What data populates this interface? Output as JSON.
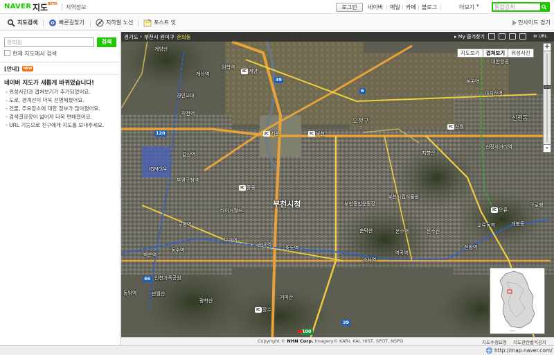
{
  "header": {
    "logo": "NAVER",
    "service": "지도",
    "beta": "BETA",
    "local_info": "지역정보",
    "login": "로그인",
    "nav": [
      "네이버",
      "메일",
      "카페",
      "블로그",
      "더보기"
    ],
    "search_placeholder": "통합검색"
  },
  "toolbar": {
    "search": "지도검색",
    "route": "빠른길찾기",
    "subway": "지하철 노선",
    "postit": "포스트 잇",
    "insight": "인사이드 경기"
  },
  "left_panel": {
    "search_value": "한의원",
    "search_button": "검색",
    "search_here_label": "현재 지도에서 검색",
    "notice_head": "[안내]",
    "new_badge": "NEW",
    "notice_title": "네이버 지도가 새롭게 바뀌었습니다!",
    "notice_lines": [
      "- 위성사진과 겹쳐보기가 추가되었어요.",
      "- 도로, 경계선이 더욱 선명해졌어요.",
      "- 건물, 주요장소에 대한 정보가 많아졌어요.",
      "- 검색결과창이 넓어져 더욱 편해졌어요.",
      "- URL 기능으로 친구에게 지도를 보내주세요."
    ]
  },
  "map": {
    "breadcrumb": [
      "경기도",
      "부천시 원미구",
      "춘의동"
    ],
    "my_favorites": "My 즐겨찾기",
    "url_label": "URL",
    "map_types": [
      {
        "label": "지도보기",
        "active": false
      },
      {
        "label": "겹쳐보기",
        "active": true
      },
      {
        "label": "위성사진",
        "active": false
      }
    ],
    "zoom_in": "+",
    "zoom_out": "-",
    "labels": {
      "gyeyangsan": "계양산",
      "imhakyeok": "임학역",
      "gyesanyeok": "계산역",
      "ic_gyeyang": "계양",
      "daehanhanggong": "대한항공",
      "hwagokyeok": "화곡역",
      "gyeongincollege": "경인교대",
      "jakjeonyeok": "작전역",
      "kkachisan": "까치산역",
      "sinjeongdong": "신정동",
      "ojeonggu": "오정구",
      "ic_seoun": "서운",
      "jc_bucheon": "부천",
      "ic_sinwol": "신월",
      "galsanyeok": "갈산역",
      "jihyangsan": "지향산",
      "sinjeongsageori": "신정사거리역",
      "igmdaewoo": "IGM대우",
      "bupyeonggucheong": "부평구청역",
      "ic_jungdong": "중동",
      "bucheonsicheong": "부천시청",
      "bucheonjonghap": "부천종합운동장",
      "bucheonsiripsikmulwon": "부천시립식물원",
      "ic_oryu": "오류",
      "oryudongyeok": "오류동역",
      "gaebongdong": "개봉동",
      "gurohaeng": "구로행",
      "taiguwaldeu": "타이거월드",
      "chundeoksan": "춘덕산",
      "onsuyeok": "온수역",
      "onsusan": "온수산",
      "bupyeongyeok": "부평역",
      "bugaeyeok": "부개역",
      "songnaeyeok": "송내역",
      "jungdongyeok": "중동역",
      "sosayeok": "소사역",
      "yeokgokyeok": "역곡역",
      "cheonwangyeok": "천왕역",
      "dongsuyeok": "동수역",
      "baegunyeok": "백운역",
      "incheongajokpark": "인천가족공원",
      "dongamyeok": "동암역",
      "manwolsan": "만월산",
      "gwanghaksan": "광학산",
      "geomasan": "거마산",
      "ic_jangsu": "장수",
      "route_39": "39",
      "route_6": "6",
      "route_120": "120",
      "route_46": "46",
      "route_39b": "39",
      "route_100": "100"
    }
  },
  "footer": {
    "copyright_prefix": "Copyright ©",
    "company": "NHN Corp.",
    "imagery": "Imagery© KARI, KAI, HIST, SPOT, NSPO",
    "map_edit": "지도수정요청",
    "map_policy": "지도관련법적공지"
  },
  "statusbar": {
    "url": "http://map.naver.com/"
  },
  "colors": {
    "naver_green": "#1ec800",
    "road_main": "#e8a23a",
    "road_yellow": "#f0d040",
    "subway_blue": "#2a5fd8"
  }
}
